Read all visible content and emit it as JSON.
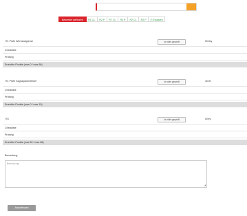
{
  "header": {
    "legend_label": "Zu komplettieren",
    "progress_fraction": 0.1
  },
  "tabs": [
    {
      "label": "Bewerber gebrannt",
      "active": true
    },
    {
      "label": "R1 CL",
      "active": false
    },
    {
      "label": "R2 P",
      "active": false
    },
    {
      "label": "R7 CL",
      "active": false
    },
    {
      "label": "R3 P",
      "active": false
    },
    {
      "label": "R2 CL",
      "active": false
    },
    {
      "label": "R2 P",
      "active": false
    },
    {
      "label": "Ersatzen",
      "active": false,
      "icon": "print-icon"
    }
  ],
  "sections": [
    {
      "title": "R1 Prüfe Werbeabgrenzt",
      "check_button": "nicht geprüft",
      "time": "00:0ey",
      "rows": [
        "Checkliste",
        "Prüfung"
      ],
      "result": "Erreichte Punkte (max 0 / max 66)"
    },
    {
      "title": "R1 Prüfe Sagnapschreiteder",
      "check_button": "nicht geprüft",
      "time": "40:00",
      "rows": [
        "Checkliste",
        "Prüfung"
      ],
      "result": "Erreichte Punkte (max 0 / max 10)"
    },
    {
      "title": "R3",
      "check_button": "nicht geprüft",
      "time": "00:ey",
      "rows": [
        "Checkliste",
        "Prüfung"
      ],
      "result": "Erreichte Punkte (max 52 / max 66)"
    }
  ],
  "comment": {
    "label": "Bemerkung",
    "placeholder": "Bemerkung"
  },
  "submit_label": "Abschliessen",
  "colors": {
    "accent_red": "#d9242b",
    "progress_orange": "#f4a227",
    "tab_green": "#2e9a44",
    "row_highlight": "#dddddd"
  }
}
